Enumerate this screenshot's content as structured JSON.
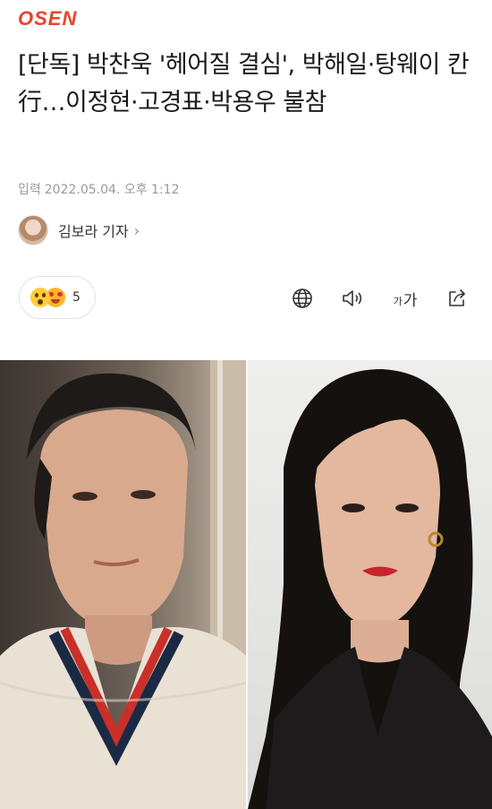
{
  "header": {
    "logo": "OSEN"
  },
  "article": {
    "headline": "[단독] 박찬욱 '헤어질 결심', 박해일·탕웨이 칸行…이정현·고경표·박용우 불참",
    "meta_label": "입력",
    "datetime": "2022.05.04. 오후 1:12",
    "author": "김보라 기자"
  },
  "toolbar": {
    "reaction_count": "5",
    "fontsize_small": "가",
    "fontsize_large": "가"
  },
  "photo": {
    "left_subject": "man in cable-knit sweater",
    "right_subject": "woman in black top with red lips"
  }
}
